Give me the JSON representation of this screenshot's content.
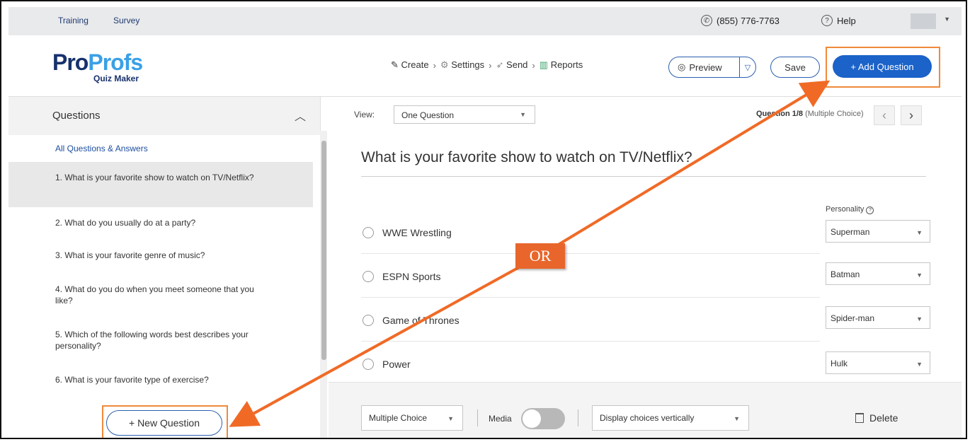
{
  "topbar": {
    "links": [
      "Training",
      "Survey"
    ],
    "phone": "(855) 776-7763",
    "help": "Help"
  },
  "logo": {
    "pro": "Pro",
    "profs": "Profs",
    "subtitle": "Quiz Maker"
  },
  "steps": [
    {
      "label": "Create",
      "icon": "pencil-icon"
    },
    {
      "label": "Settings",
      "icon": "gear-icon"
    },
    {
      "label": "Send",
      "icon": "send-icon"
    },
    {
      "label": "Reports",
      "icon": "bar-chart-icon"
    }
  ],
  "header_buttons": {
    "preview": "Preview",
    "save": "Save",
    "add_question": "+ Add Question"
  },
  "sidebar": {
    "title": "Questions",
    "all_link": "All Questions & Answers",
    "questions": [
      "1. What is your favorite show to watch on TV/Netflix?",
      "2. What do you usually do at a party?",
      "3. What is your favorite genre of music?",
      "4. What do you do when you meet someone that you like?",
      "5. Which of the following words best describes your personality?",
      "6. What is your favorite type of exercise?"
    ],
    "selected_index": 0,
    "new_question": "+ New Question"
  },
  "view": {
    "label": "View:",
    "selected": "One Question",
    "question_position": "Question 1/8",
    "question_type": "(Multiple Choice)"
  },
  "question": {
    "title": "What is your favorite show to watch on TV/Netflix?",
    "personality_label": "Personality",
    "answers": [
      {
        "text": "WWE Wrestling",
        "personality": "Superman"
      },
      {
        "text": "ESPN Sports",
        "personality": "Batman"
      },
      {
        "text": "Game of Thrones",
        "personality": "Spider-man"
      },
      {
        "text": "Power",
        "personality": "Hulk"
      }
    ]
  },
  "footer": {
    "type_select": "Multiple Choice",
    "media_label": "Media",
    "media_on": false,
    "display_select": "Display choices vertically",
    "delete": "Delete"
  },
  "annotation": {
    "or_label": "OR",
    "color": "#f08a3a"
  }
}
